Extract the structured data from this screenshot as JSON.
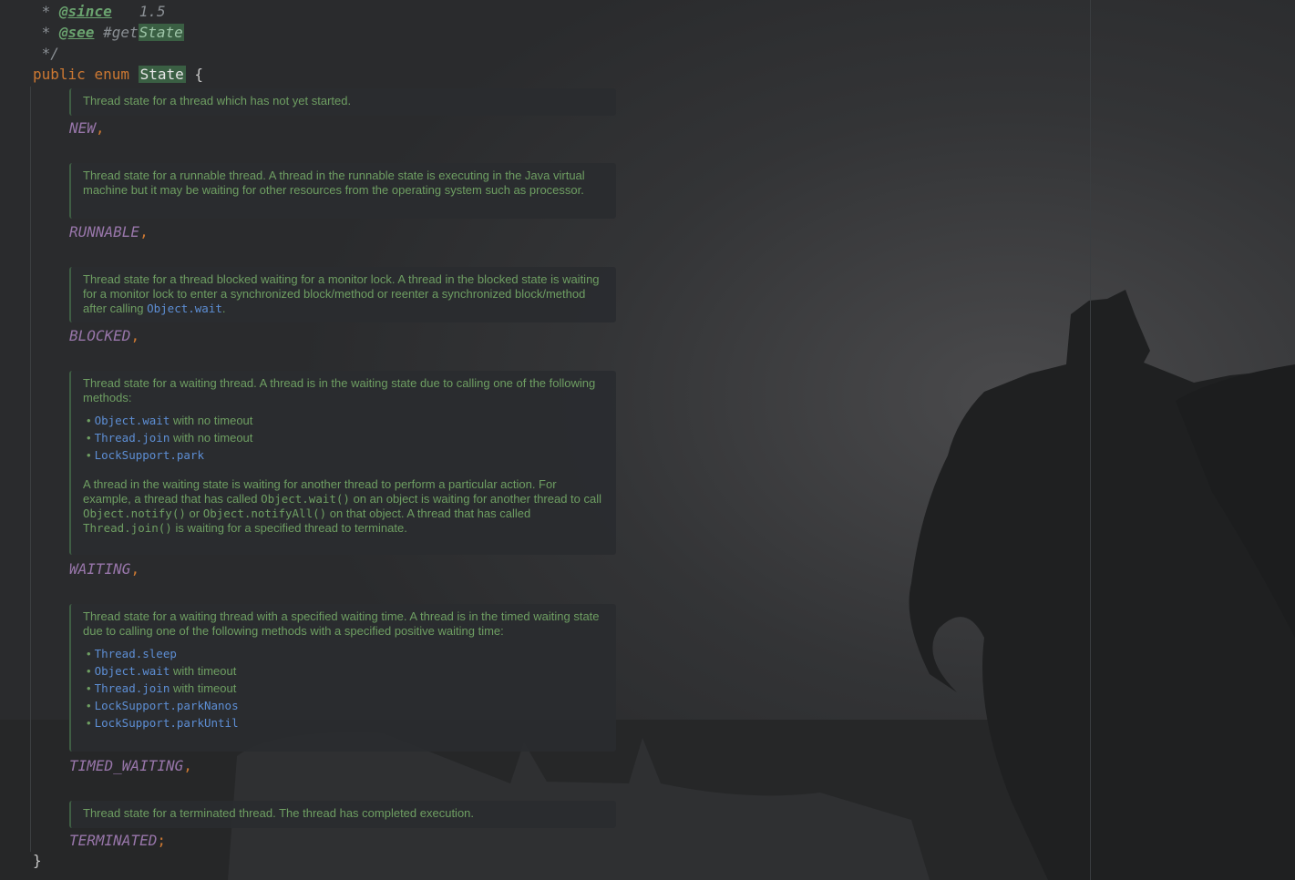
{
  "code": {
    "line1": {
      "prefix": " * ",
      "tag": "@since",
      "value": "1.5"
    },
    "line2": {
      "prefix": " * ",
      "tag": "@see",
      "ref": "#get",
      "ref_hl": "State"
    },
    "line3": " */",
    "decl": {
      "kw_public": "public",
      "kw_enum": "enum",
      "name": "State",
      "brace": "{"
    },
    "closing_brace": "}"
  },
  "constants": [
    {
      "name": "NEW",
      "punct": ","
    },
    {
      "name": "RUNNABLE",
      "punct": ","
    },
    {
      "name": "BLOCKED",
      "punct": ","
    },
    {
      "name": "WAITING",
      "punct": ","
    },
    {
      "name": "TIMED_WAITING",
      "punct": ","
    },
    {
      "name": "TERMINATED",
      "punct": ";"
    }
  ],
  "docs": {
    "new": "Thread state for a thread which has not yet started.",
    "runnable": "Thread state for a runnable thread. A thread in the runnable state is executing in the Java virtual machine but it may be waiting for other resources from the operating system such as processor.",
    "blocked": {
      "text": "Thread state for a thread blocked waiting for a monitor lock. A thread in the blocked state is waiting for a monitor lock to enter a synchronized block/method or reenter a synchronized block/method after calling ",
      "link": "Object.wait",
      "end": "."
    },
    "waiting": {
      "intro": "Thread state for a waiting thread. A thread is in the waiting state due to calling one of the following methods:",
      "items": [
        {
          "link": "Object.wait",
          "suffix": " with no timeout"
        },
        {
          "link": "Thread.join",
          "suffix": " with no timeout"
        },
        {
          "link": "LockSupport.park",
          "suffix": ""
        }
      ],
      "p2_a": "A thread in the waiting state is waiting for another thread to perform a particular action. For example, a thread that has called ",
      "p2_code1": "Object.wait()",
      "p2_b": " on an object is waiting for another thread to call ",
      "p2_code2": "Object.notify()",
      "p2_c": " or ",
      "p2_code3": "Object.notifyAll()",
      "p2_d": " on that object. A thread that has called ",
      "p2_code4": "Thread.join()",
      "p2_e": " is waiting for a specified thread to terminate."
    },
    "timed_waiting": {
      "intro": "Thread state for a waiting thread with a specified waiting time. A thread is in the timed waiting state due to calling one of the following methods with a specified positive waiting time:",
      "items": [
        {
          "link": "Thread.sleep",
          "suffix": ""
        },
        {
          "link": "Object.wait",
          "suffix": " with timeout"
        },
        {
          "link": "Thread.join",
          "suffix": " with timeout"
        },
        {
          "link": "LockSupport.parkNanos",
          "suffix": ""
        },
        {
          "link": "LockSupport.parkUntil",
          "suffix": ""
        }
      ]
    },
    "terminated": "Thread state for a terminated thread. The thread has completed execution."
  },
  "bullet": "•",
  "colors": {
    "background": "#2a2b2d",
    "keyword": "#cc7832",
    "constant": "#9876aa",
    "doc_text": "#6e9e62",
    "doc_link": "#5d8ed4",
    "highlight": "#3a5f43"
  }
}
